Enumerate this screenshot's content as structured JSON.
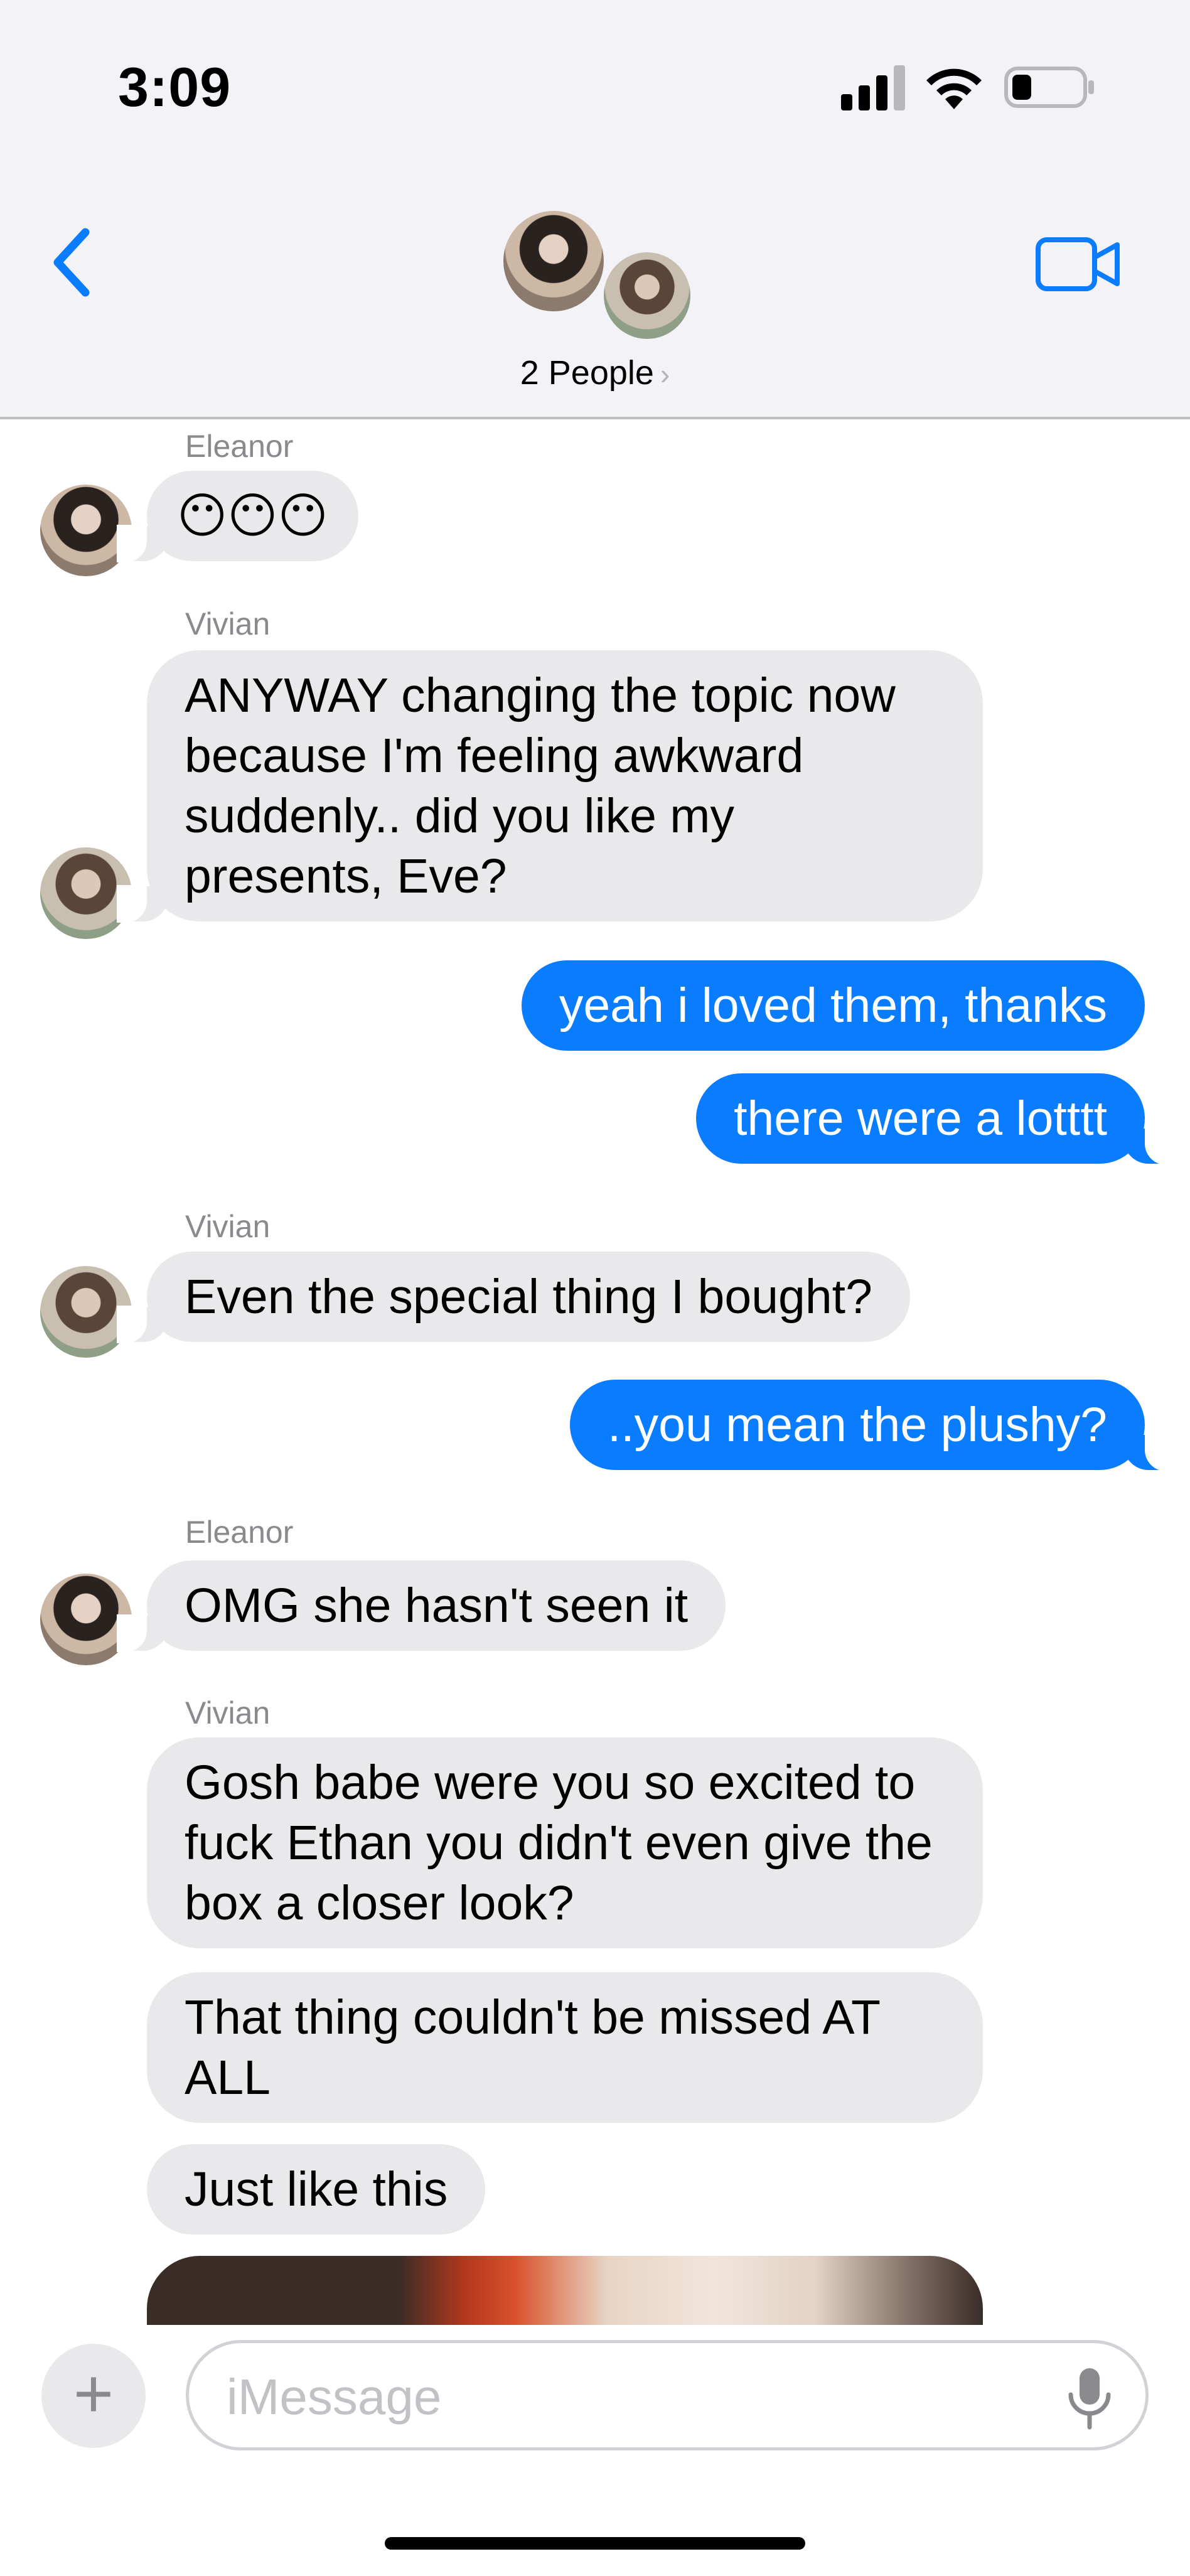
{
  "status_bar": {
    "time": "3:09"
  },
  "header": {
    "title": "2 People",
    "title_chevron": "›"
  },
  "messages": [
    {
      "sender": "Eleanor",
      "direction": "incoming",
      "text": "😶😶😶"
    },
    {
      "sender": "Vivian",
      "direction": "incoming",
      "text": "ANYWAY changing the topic now because I'm feeling awkward suddenly.. did you like my presents, Eve?"
    },
    {
      "sender": "",
      "direction": "outgoing",
      "text": "yeah i loved them, thanks"
    },
    {
      "sender": "",
      "direction": "outgoing",
      "text": "there were a lotttt"
    },
    {
      "sender": "Vivian",
      "direction": "incoming",
      "text": "Even the special thing I bought?"
    },
    {
      "sender": "",
      "direction": "outgoing",
      "text": "..you mean the plushy?"
    },
    {
      "sender": "Eleanor",
      "direction": "incoming",
      "text": "OMG she hasn't seen it"
    },
    {
      "sender": "Vivian",
      "direction": "incoming",
      "text": "Gosh babe were you so excited to fuck Ethan you didn't even give the box a closer look?"
    },
    {
      "sender": "",
      "direction": "incoming",
      "text": "That thing couldn't be missed AT ALL"
    },
    {
      "sender": "",
      "direction": "incoming",
      "text": "Just like this"
    }
  ],
  "composer": {
    "placeholder": "iMessage",
    "plus_label": "+"
  },
  "icons": {
    "back": "chevron-left-icon",
    "video": "video-camera-icon",
    "mic": "microphone-icon",
    "signal": "cellular-signal-icon",
    "wifi": "wifi-icon",
    "battery": "battery-icon"
  },
  "colors": {
    "accent": "#0a7cff",
    "incoming_bubble": "#e9e9eb",
    "header_bg": "#f2f2f7",
    "meta_text": "#8a8a8e"
  }
}
